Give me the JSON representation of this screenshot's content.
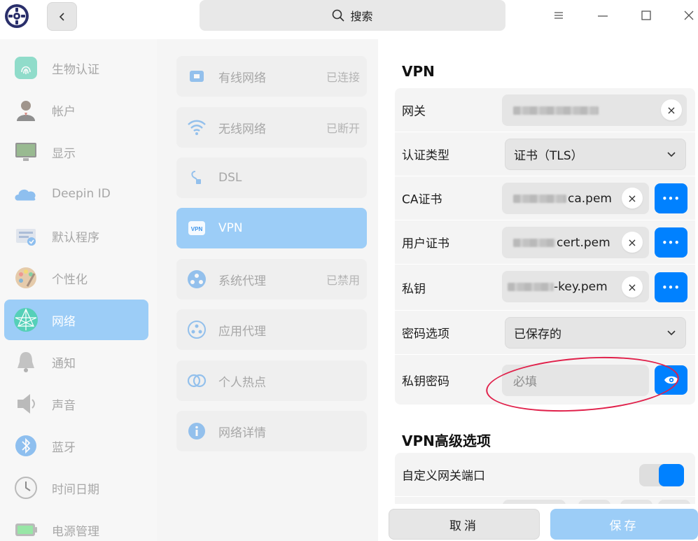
{
  "titlebar": {
    "search_placeholder": "搜索",
    "back_icon": "chevron-left-icon",
    "menu_icon": "hamburger-icon",
    "minimize_icon": "minimize-icon",
    "maximize_icon": "maximize-icon",
    "close_icon": "close-icon"
  },
  "sidebar": {
    "items": [
      {
        "label": "生物认证",
        "icon": "fingerprint-icon"
      },
      {
        "label": "帐户",
        "icon": "account-icon"
      },
      {
        "label": "显示",
        "icon": "display-icon"
      },
      {
        "label": "Deepin ID",
        "icon": "cloud-icon"
      },
      {
        "label": "默认程序",
        "icon": "default-apps-icon"
      },
      {
        "label": "个性化",
        "icon": "palette-icon"
      },
      {
        "label": "网络",
        "icon": "network-icon",
        "active": true
      },
      {
        "label": "通知",
        "icon": "bell-icon"
      },
      {
        "label": "声音",
        "icon": "speaker-icon"
      },
      {
        "label": "蓝牙",
        "icon": "bluetooth-icon"
      },
      {
        "label": "时间日期",
        "icon": "clock-icon"
      },
      {
        "label": "电源管理",
        "icon": "battery-icon"
      }
    ]
  },
  "network_list": {
    "items": [
      {
        "label": "有线网络",
        "status": "已连接",
        "icon": "wired-icon"
      },
      {
        "label": "无线网络",
        "status": "已断开",
        "icon": "wifi-icon"
      },
      {
        "label": "DSL",
        "status": "",
        "icon": "dsl-icon"
      },
      {
        "label": "VPN",
        "status": "",
        "icon": "vpn-icon",
        "active": true
      },
      {
        "label": "系统代理",
        "status": "已禁用",
        "icon": "system-proxy-icon"
      },
      {
        "label": "应用代理",
        "status": "",
        "icon": "app-proxy-icon"
      },
      {
        "label": "个人热点",
        "status": "",
        "icon": "hotspot-icon"
      },
      {
        "label": "网络详情",
        "status": "",
        "icon": "info-icon"
      }
    ]
  },
  "vpn": {
    "section_title": "VPN",
    "rows": {
      "gateway": {
        "label": "网关"
      },
      "auth_type": {
        "label": "认证类型",
        "value": "证书（TLS）"
      },
      "ca_cert": {
        "label": "CA证书",
        "value_suffix": "ca.pem"
      },
      "user_cert": {
        "label": "用户证书",
        "value_suffix": "cert.pem"
      },
      "private_key": {
        "label": "私钥",
        "value_suffix": "-key.pem"
      },
      "password_option": {
        "label": "密码选项",
        "value": "已保存的"
      },
      "key_password": {
        "label": "私钥密码",
        "placeholder": "必填"
      }
    },
    "more_label": "•••",
    "clear_label": "×"
  },
  "vpn_advanced": {
    "section_title": "VPN高级选项",
    "custom_gateway_port": {
      "label": "自定义网关端口",
      "enabled": true
    }
  },
  "footer": {
    "cancel_label": "取消",
    "save_label": "保存"
  },
  "colors": {
    "accent": "#0081ff",
    "active_bg": "#9ccdf7",
    "annotation": "#e0204a"
  }
}
